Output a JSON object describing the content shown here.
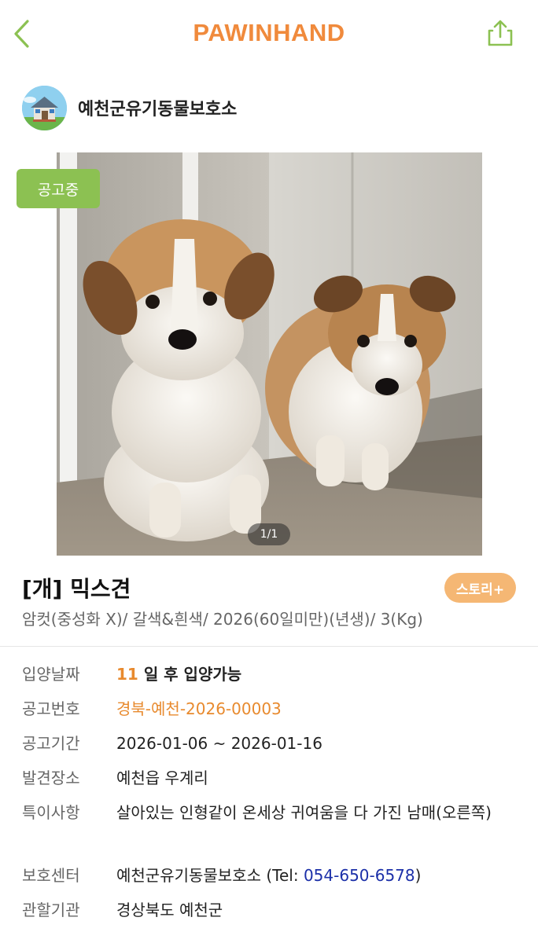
{
  "header": {
    "logo": "PAWINHAND",
    "back_icon": "chevron-left-icon",
    "share_icon": "share-icon",
    "accent": "#f08a3c",
    "icon_color": "#8cc152"
  },
  "shelter": {
    "name": "예천군유기동물보호소",
    "avatar_icon": "house-icon"
  },
  "photo": {
    "status_badge": "공고중",
    "counter": "1/1",
    "badge_color": "#8cc152"
  },
  "animal": {
    "title": "[개] 믹스견",
    "story_button": "스토리+",
    "summary": "암컷(중성화 X)/ 갈색&흰색/ 2026(60일미만)(년생)/ 3(Kg)"
  },
  "details": {
    "adoption_label": "입양날짜",
    "adoption_days": "11",
    "adoption_suffix": "일 후 입양가능",
    "notice_label": "공고번호",
    "notice_value": "경북-예천-2026-00003",
    "period_label": "공고기간",
    "period_value": "2026-01-06 ~ 2026-01-16",
    "found_label": "발견장소",
    "found_value": "예천읍 우계리",
    "notes_label": "특이사항",
    "notes_value": "살아있는 인형같이 온세상 귀여움을 다 가진 남매(오른쪽)",
    "center_label": "보호센터",
    "center_name": "예천군유기동물보호소",
    "center_tel_prefix": "(Tel:",
    "center_tel": "054-650-6578",
    "center_tel_suffix": ")",
    "agency_label": "관할기관",
    "agency_value": "경상북도 예천군"
  }
}
